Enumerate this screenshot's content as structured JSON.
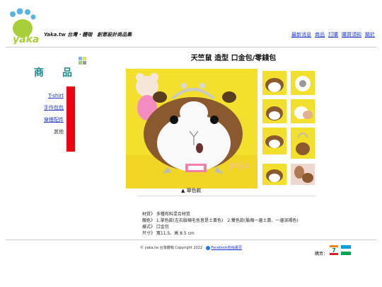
{
  "brand": {
    "logo_text": "yaka",
    "tagline": "Yaka.tw 台灣・體咖　創意設計商品集"
  },
  "topnav": [
    "最新消息",
    "商品",
    "訂購",
    "購買須知",
    "關於"
  ],
  "section_title": [
    "商",
    "品"
  ],
  "categories": [
    "T-shirt",
    "手作包包",
    "穿搭配件",
    "其他"
  ],
  "product": {
    "title": "天竺鼠 造型 口金包/零錢包",
    "image_caption": "▲ 單色款",
    "watermark": "yaka"
  },
  "specs": [
    "材質》 多種布料混合材質",
    "顏色》 1.單色款(左右臉頰毛色皆是土黃色)　2.雙色款(臉頰一邊土黃、一邊深褐色)",
    "樣式》 口金包",
    "尺寸》 寬11.5、高 8.5 cm"
  ],
  "footer": {
    "copyright": "© yaka.tw 台灣體咖 Copyright 2022",
    "facebook_label": "Facebook粉絲專頁",
    "buy_label": "購買："
  },
  "colors": {
    "accent": "#1a8a8a",
    "sidebar_bar": "#ee0011",
    "link": "#1a33cc",
    "product_bg": "#f3df2d"
  }
}
